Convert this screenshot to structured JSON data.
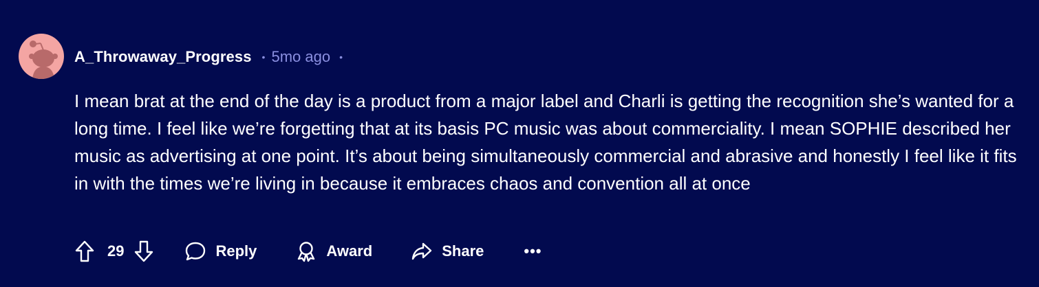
{
  "comment": {
    "author": "A_Throwaway_Progress",
    "separator": "•",
    "timestamp": "5mo ago",
    "body": "I mean brat at the end of the day is a product from a major label and Charli is getting the recognition she’s wanted for a long time. I feel like we’re forgetting that at its basis PC music was about commerciality. I mean SOPHIE described her music as advertising at one point. It’s about being simultaneously commercial and abrasive and honestly I feel like it fits in with the times we’re living in because it embraces chaos and convention all at once"
  },
  "actions": {
    "vote_count": "29",
    "reply_label": "Reply",
    "award_label": "Award",
    "share_label": "Share",
    "more_label": "•••"
  },
  "icons": {
    "avatar": "snoo-avatar-icon",
    "upvote": "upvote-arrow-icon",
    "downvote": "downvote-arrow-icon",
    "reply": "speech-bubble-icon",
    "award": "award-ribbon-icon",
    "share": "share-arrow-icon",
    "more": "ellipsis-icon"
  },
  "colors": {
    "background": "#020a4f",
    "text": "#ffffff",
    "meta": "#8a8fe0",
    "avatar_bg": "#f4a5a3",
    "avatar_figure": "#b86a6a"
  }
}
